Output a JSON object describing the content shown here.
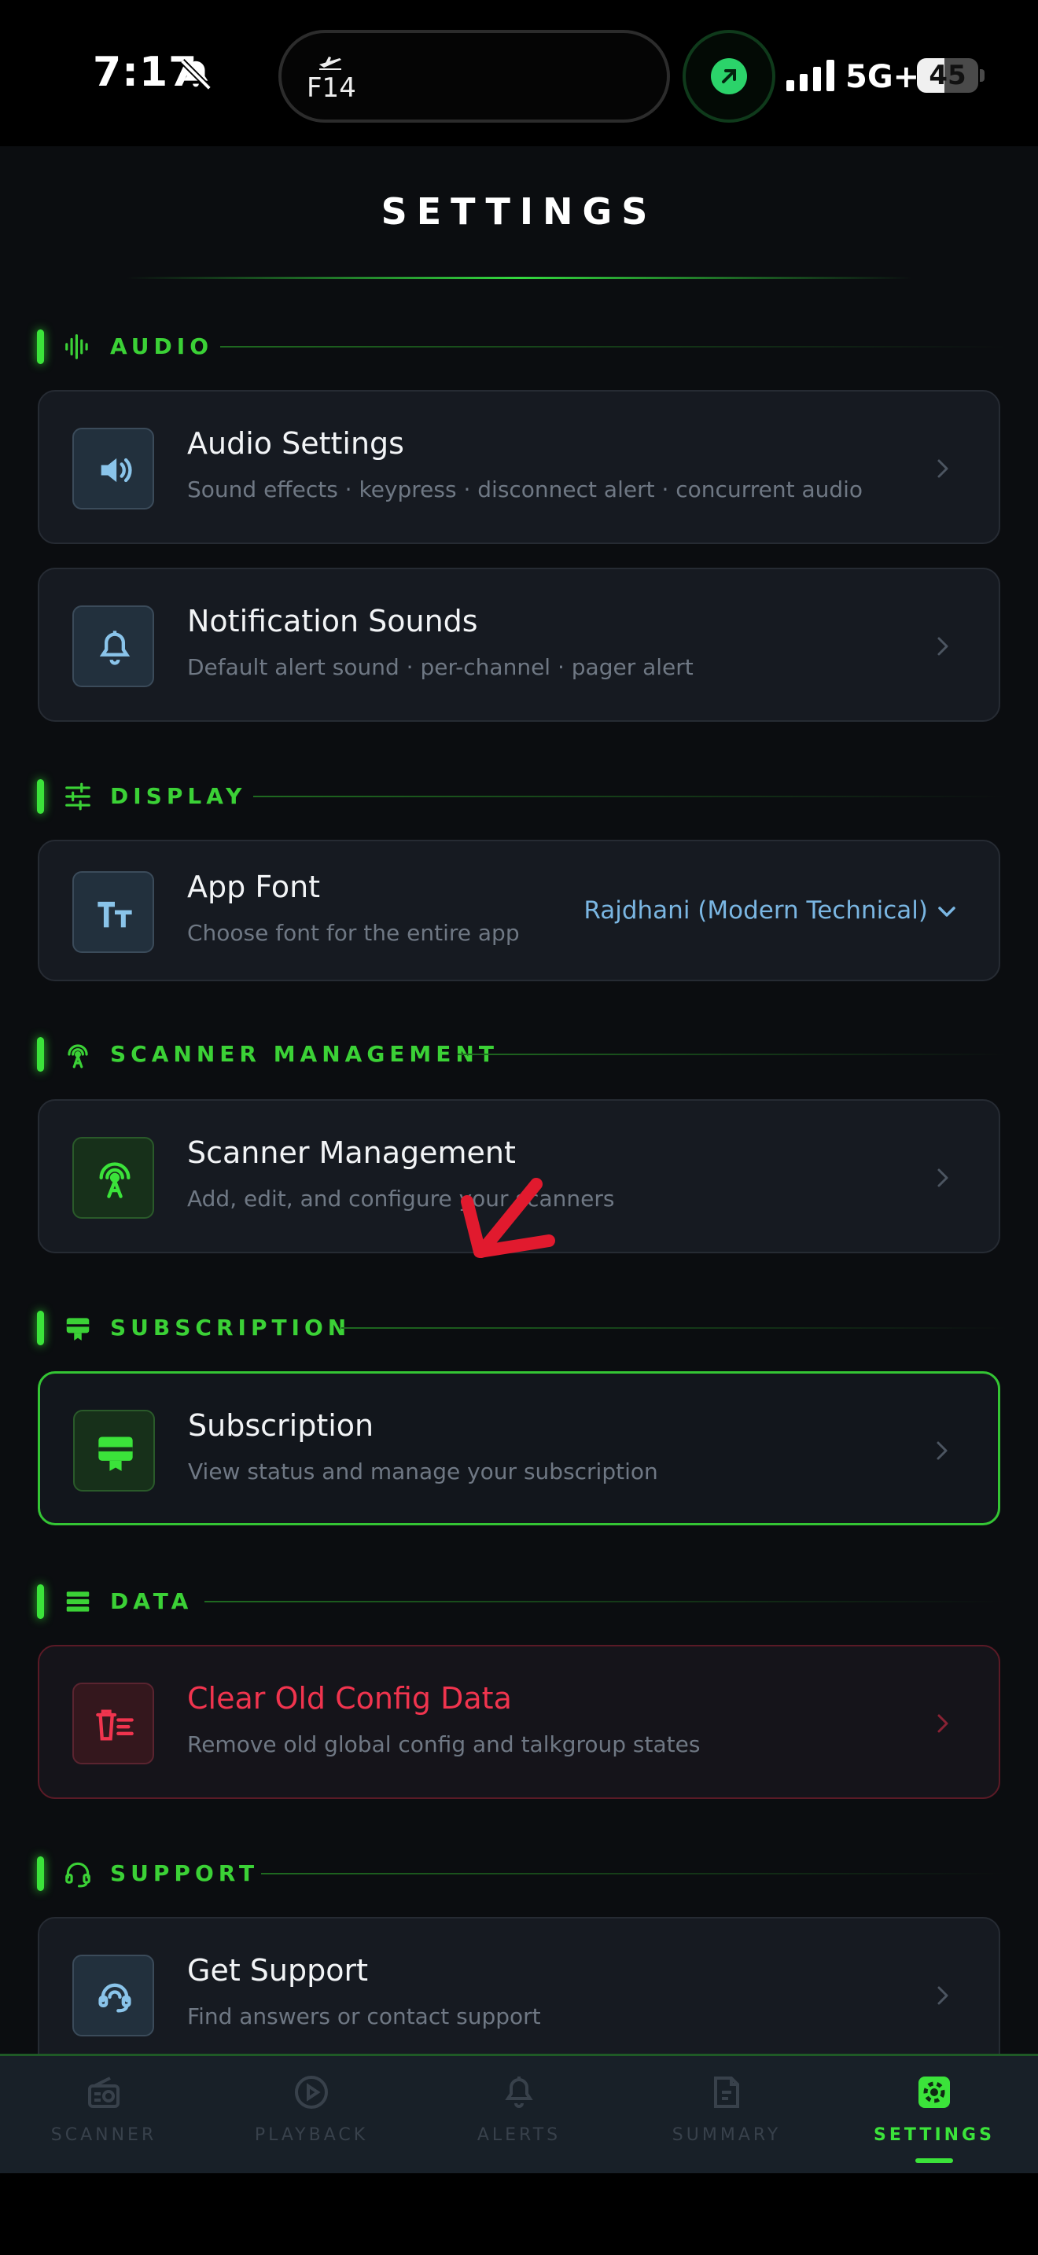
{
  "status_bar": {
    "time": "7:17",
    "island_text": "F14",
    "network": "5G+",
    "battery": "45",
    "battery_level": 0.45
  },
  "page": {
    "title": "SETTINGS"
  },
  "sections": {
    "audio": {
      "label": "AUDIO",
      "cards": {
        "audio_settings": {
          "title": "Audio Settings",
          "subtitle": "Sound effects · keypress · disconnect alert · concurrent audio"
        },
        "notification_sounds": {
          "title": "Notification Sounds",
          "subtitle": "Default alert sound · per-channel · pager alert"
        }
      }
    },
    "display": {
      "label": "DISPLAY",
      "cards": {
        "app_font": {
          "title": "App Font",
          "subtitle": "Choose font for the entire app",
          "selected": "Rajdhani (Modern Technical)"
        }
      }
    },
    "scanner": {
      "label": "SCANNER MANAGEMENT",
      "cards": {
        "scanner_management": {
          "title": "Scanner Management",
          "subtitle": "Add, edit, and configure your scanners"
        }
      }
    },
    "subscription": {
      "label": "SUBSCRIPTION",
      "cards": {
        "subscription": {
          "title": "Subscription",
          "subtitle": "View status and manage your subscription"
        }
      }
    },
    "data": {
      "label": "DATA",
      "cards": {
        "clear_config": {
          "title": "Clear Old Config Data",
          "subtitle": "Remove old global config and talkgroup states"
        }
      }
    },
    "support": {
      "label": "SUPPORT",
      "cards": {
        "get_support": {
          "title": "Get Support",
          "subtitle": "Find answers or contact support"
        }
      }
    }
  },
  "tabs": [
    {
      "label": "SCANNER",
      "icon": "radio-icon"
    },
    {
      "label": "PLAYBACK",
      "icon": "play-icon"
    },
    {
      "label": "ALERTS",
      "icon": "bell-icon"
    },
    {
      "label": "SUMMARY",
      "icon": "document-icon"
    },
    {
      "label": "SETTINGS",
      "icon": "gear-icon",
      "active": true
    }
  ],
  "colors": {
    "accent_green": "#3be33a",
    "danger_red": "#f0344e",
    "link_blue": "#7ab6e2",
    "background": "#0b0d10",
    "card": "#161a21"
  }
}
